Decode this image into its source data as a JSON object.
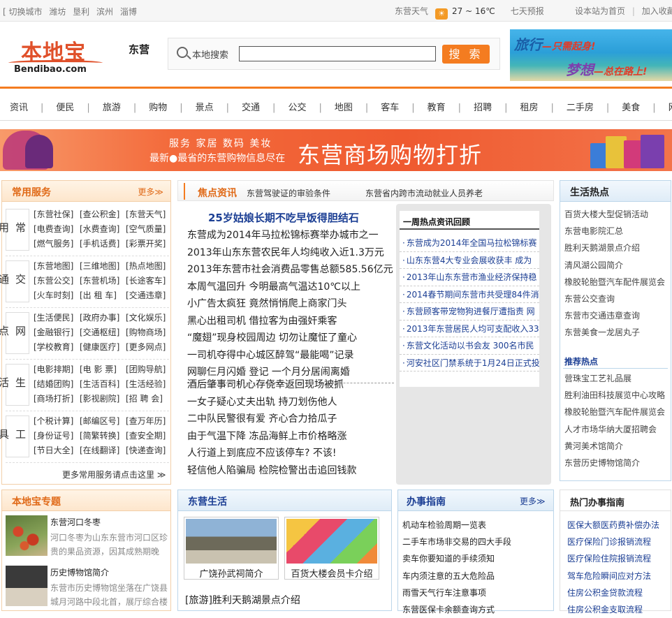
{
  "topbar": {
    "switch_city": "[ 切换城市",
    "cities": [
      "潍坊",
      "垦利",
      "滨州",
      "淄博"
    ],
    "weather_label": "东营天气",
    "weather_icon": "sun-cloud-icon",
    "temperature": "27 ~ 16℃",
    "forecast": "七天预报",
    "set_home": "设本站为首页",
    "separator": "|",
    "add_fav": "加入收藏"
  },
  "header": {
    "logo_cn": "本地宝",
    "logo_en": "Bendibao.com",
    "city": "东营",
    "search_label": "本地搜索",
    "search_value": "",
    "search_button": "搜 索",
    "banner_travel": "旅行",
    "banner_travel_sub": "—只需起身!",
    "banner_dream": "梦想",
    "banner_dream_sub": "—总在路上!"
  },
  "nav": [
    "资讯",
    "便民",
    "旅游",
    "购物",
    "景点",
    "交通",
    "公交",
    "地图",
    "客车",
    "教育",
    "招聘",
    "租房",
    "二手房",
    "美食",
    "网点"
  ],
  "nav_sep": "|",
  "promo": {
    "tags": "服务  家居  数码  美妆",
    "sub": "最新●最省的东营购物信息尽在",
    "big": "东营商场购物打折"
  },
  "services": {
    "title": "常用服务",
    "more": "更多≫",
    "groups": [
      {
        "cat": "常用",
        "items": [
          "[东营社保]",
          "[查公积金]",
          "[东营天气]",
          "[电费查询]",
          "[水费查询]",
          "[空气质量]",
          "[燃气服务]",
          "[手机话费]",
          "[彩票开奖]"
        ]
      },
      {
        "cat": "交通",
        "items": [
          "[东营地图]",
          "[三维地图]",
          "[热点地图]",
          "[东营公交]",
          "[东营机场]",
          "[长途客车]",
          "[火车时刻]",
          "[出 租 车]",
          "[交通违章]"
        ]
      },
      {
        "cat": "网点",
        "items": [
          "[生活便民]",
          "[政府办事]",
          "[文化娱乐]",
          "[金融银行]",
          "[交通枢纽]",
          "[购物商场]",
          "[学校教育]",
          "[健康医疗]",
          "[更多网点]"
        ]
      },
      {
        "cat": "生活",
        "items": [
          "[电影排期]",
          "[电 影 票]",
          "[团购导航]",
          "[结婚团购]",
          "[生活百科]",
          "[生活经验]",
          "[商场打折]",
          "[影视剧院]",
          "[招 聘 会]"
        ]
      },
      {
        "cat": "工具",
        "items": [
          "[个税计算]",
          "[邮编区号]",
          "[查万年历]",
          "[身份证号]",
          "[简繁转换]",
          "[查安全期]",
          "[节日大全]",
          "[在线翻译]",
          "[快递查询]"
        ]
      }
    ],
    "footer": "更多常用服务请点击这里 ≫"
  },
  "focus": {
    "title": "焦点资讯",
    "top_links": [
      "东营驾驶证的审验条件",
      "东营省内跨市流动就业人员养老"
    ],
    "headline": "25岁姑娘长期不吃早饭得胆结石",
    "news1": [
      "东营成为2014年马拉松锦标赛举办城市之一",
      "2013年山东东营农民年人均纯收入近1.3万元",
      "2013年东营市社会消费品零售总额585.56亿元",
      "本周气温回升 今明最高气温达10℃以上",
      "小广告太疯狂 竟然悄悄爬上商家门头",
      "黑心出租司机 借拉客为由强奸乘客",
      "“魔翅”现身校园周边 切勿让魔怔了童心",
      "一司机夺得中心城区醉驾“最能喝”记录",
      "网聊仨月闪婚 登记 一个月分居闹离婚"
    ],
    "news2": [
      "酒后肇事司机心存侥幸返回现场被抓",
      "一女子疑心丈夫出轨 持刀划伤他人",
      "二中队民警很有爱 齐心合力拾瓜子",
      "由于气温下降 冻品海鲜上市价格略涨",
      "人行道上到底应不应该停车? 不该!",
      "轻信他人陷骗局 检院检警出击追回钱款"
    ],
    "weekly_title": "一周热点资讯回顾",
    "weekly": [
      "东营成为2014年全国马拉松锦标赛",
      "山东东营4大专业会展收获丰 成为",
      "2013年山东东营市渔业经济保持稳",
      "2014春节期间东营市共受理84件消",
      "东营顾客带宠物狗进餐厅遭指责 网",
      "2013年东营居民人均可支配收入33",
      "东营文化活动以书会友 300名市民",
      "河安社区门禁系统于1月24日正式投"
    ]
  },
  "lifehot": {
    "title": "生活热点",
    "items": [
      "百货大楼大型促销活动",
      "东营电影院汇总",
      "胜利天鹅湖景点介绍",
      "清风湖公园简介",
      "橡胶轮胎暨汽车配件展览会",
      "东营公交查询",
      "东营市交通违章查询",
      "东营美食一龙居丸子"
    ],
    "sub_title": "推荐热点",
    "sub_items": [
      "营珠宝工艺礼品展",
      "胜利油田科技展览中心攻略",
      "橡胶轮胎暨汽车配件展览会",
      "人才市场华纳大厦招聘会",
      "黄河美术馆简介",
      "东营历史博物馆简介"
    ]
  },
  "special": {
    "title": "本地宝专题",
    "items": [
      {
        "title": "东营河口冬枣",
        "desc": "河口冬枣为山东东营市河口区珍贵的果品资源，因其成熟期晚"
      },
      {
        "title": "历史博物馆简介",
        "desc": "东营市历史博物馆坐落在广饶县城月河路中段北首，展厅综合楼"
      }
    ]
  },
  "dylife": {
    "title": "东营生活",
    "pics": [
      "广饶孙武祠简介",
      "百货大楼会员卡介绍"
    ],
    "link": "[旅游]胜利天鹅湖景点介绍"
  },
  "guide": {
    "title": "办事指南",
    "more": "更多≫",
    "items": [
      "机动车检验周期一览表",
      "二手车市场非交易的四大手段",
      "卖车你要知道的手续须知",
      "车内须注意的五大危险品",
      "雨雪天气行车注意事项",
      "东营医保卡余额查询方式"
    ]
  },
  "hotguide": {
    "title": "热门办事指南",
    "items": [
      "医保大额医药费补偿办法",
      "医疗保险门诊报销流程",
      "医疗保险住院报销流程",
      "驾车危险瞬间应对方法",
      "住房公积金贷款流程",
      "住房公积金支取流程"
    ]
  },
  "colors": {
    "accent": "#f47c20",
    "link_blue": "#1c3f94",
    "panel_border": "#f2cfa9"
  }
}
